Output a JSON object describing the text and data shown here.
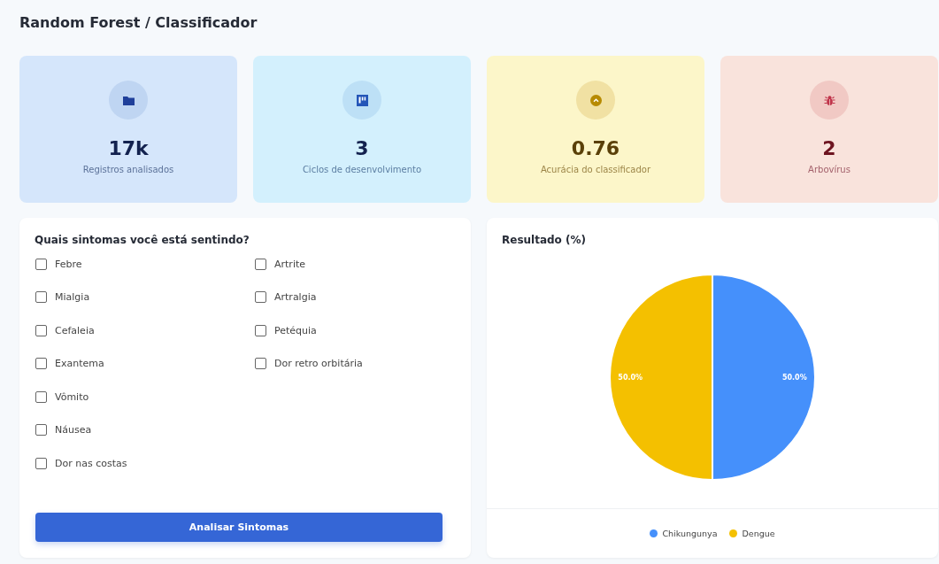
{
  "page": {
    "title": "Random Forest / Classificador"
  },
  "stats": [
    {
      "kind": "folder",
      "value": "17k",
      "label": "Registros analisados",
      "color": "#d5e6fb"
    },
    {
      "kind": "board",
      "value": "3",
      "label": "Ciclos de desenvolvimento",
      "color": "#d3f0fd"
    },
    {
      "kind": "gauge",
      "value": "0.76",
      "label": "Acurácia do classificador",
      "color": "#fcf6c9"
    },
    {
      "kind": "bug",
      "value": "2",
      "label": "Arbovírus",
      "color": "#f9e3dc"
    }
  ],
  "symptoms": {
    "title": "Quais sintomas você está sentindo?",
    "columns": [
      [
        {
          "label": "Febre",
          "checked": false
        },
        {
          "label": "Mialgia",
          "checked": false
        },
        {
          "label": "Cefaleia",
          "checked": false
        },
        {
          "label": "Exantema",
          "checked": false
        },
        {
          "label": "Vômito",
          "checked": false
        },
        {
          "label": "Náusea",
          "checked": false
        },
        {
          "label": "Dor nas costas",
          "checked": false
        }
      ],
      [
        {
          "label": "Artrite",
          "checked": false
        },
        {
          "label": "Artralgia",
          "checked": false
        },
        {
          "label": "Petéquia",
          "checked": false
        },
        {
          "label": "Dor retro orbitária",
          "checked": false
        }
      ]
    ],
    "button": "Analisar Sintomas"
  },
  "result": {
    "title": "Resultado (%)",
    "chart_data": {
      "type": "pie",
      "categories": [
        "Chikungunya",
        "Dengue"
      ],
      "values": [
        50,
        50
      ],
      "value_labels": [
        "50.0%",
        "50.0%"
      ]
    },
    "legend": [
      {
        "color": "#4590fb"
      },
      {
        "color": "#f4c000"
      }
    ]
  }
}
